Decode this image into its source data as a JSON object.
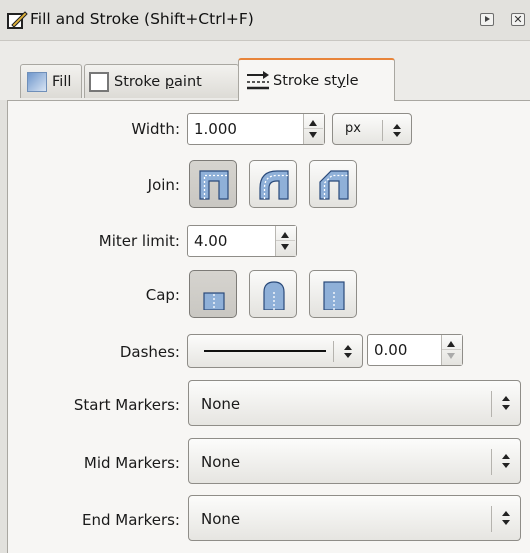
{
  "window": {
    "title": "Fill and Stroke (Shift+Ctrl+F)",
    "close_glyph": "✕"
  },
  "tabs": [
    {
      "label": "Fill",
      "icon": "fill-swatch-icon",
      "active": false
    },
    {
      "label": "Stroke paint",
      "icon": "stroke-paint-swatch-icon",
      "active": false
    },
    {
      "label": "Stroke style",
      "icon": "stroke-style-icon",
      "active": true
    }
  ],
  "stroke_style": {
    "width": {
      "label": "Width:",
      "value": "1.000",
      "unit": "px"
    },
    "join": {
      "label": "Join:",
      "options": [
        "miter-join",
        "round-join",
        "bevel-join"
      ],
      "selected": "miter-join"
    },
    "miter_limit": {
      "label": "Miter limit:",
      "value": "4.00"
    },
    "cap": {
      "label": "Cap:",
      "options": [
        "butt-cap",
        "round-cap",
        "square-cap"
      ],
      "selected": "butt-cap"
    },
    "dashes": {
      "label": "Dashes:",
      "pattern": "solid",
      "offset": "0.00"
    },
    "start_markers": {
      "label": "Start Markers:",
      "value": "None"
    },
    "mid_markers": {
      "label": "Mid Markers:",
      "value": "None"
    },
    "end_markers": {
      "label": "End Markers:",
      "value": "None"
    }
  },
  "colors": {
    "accent_tab": "#e8843a",
    "icon_blue": "#8fb0d8",
    "panel_bg": "#f7f6f4"
  }
}
